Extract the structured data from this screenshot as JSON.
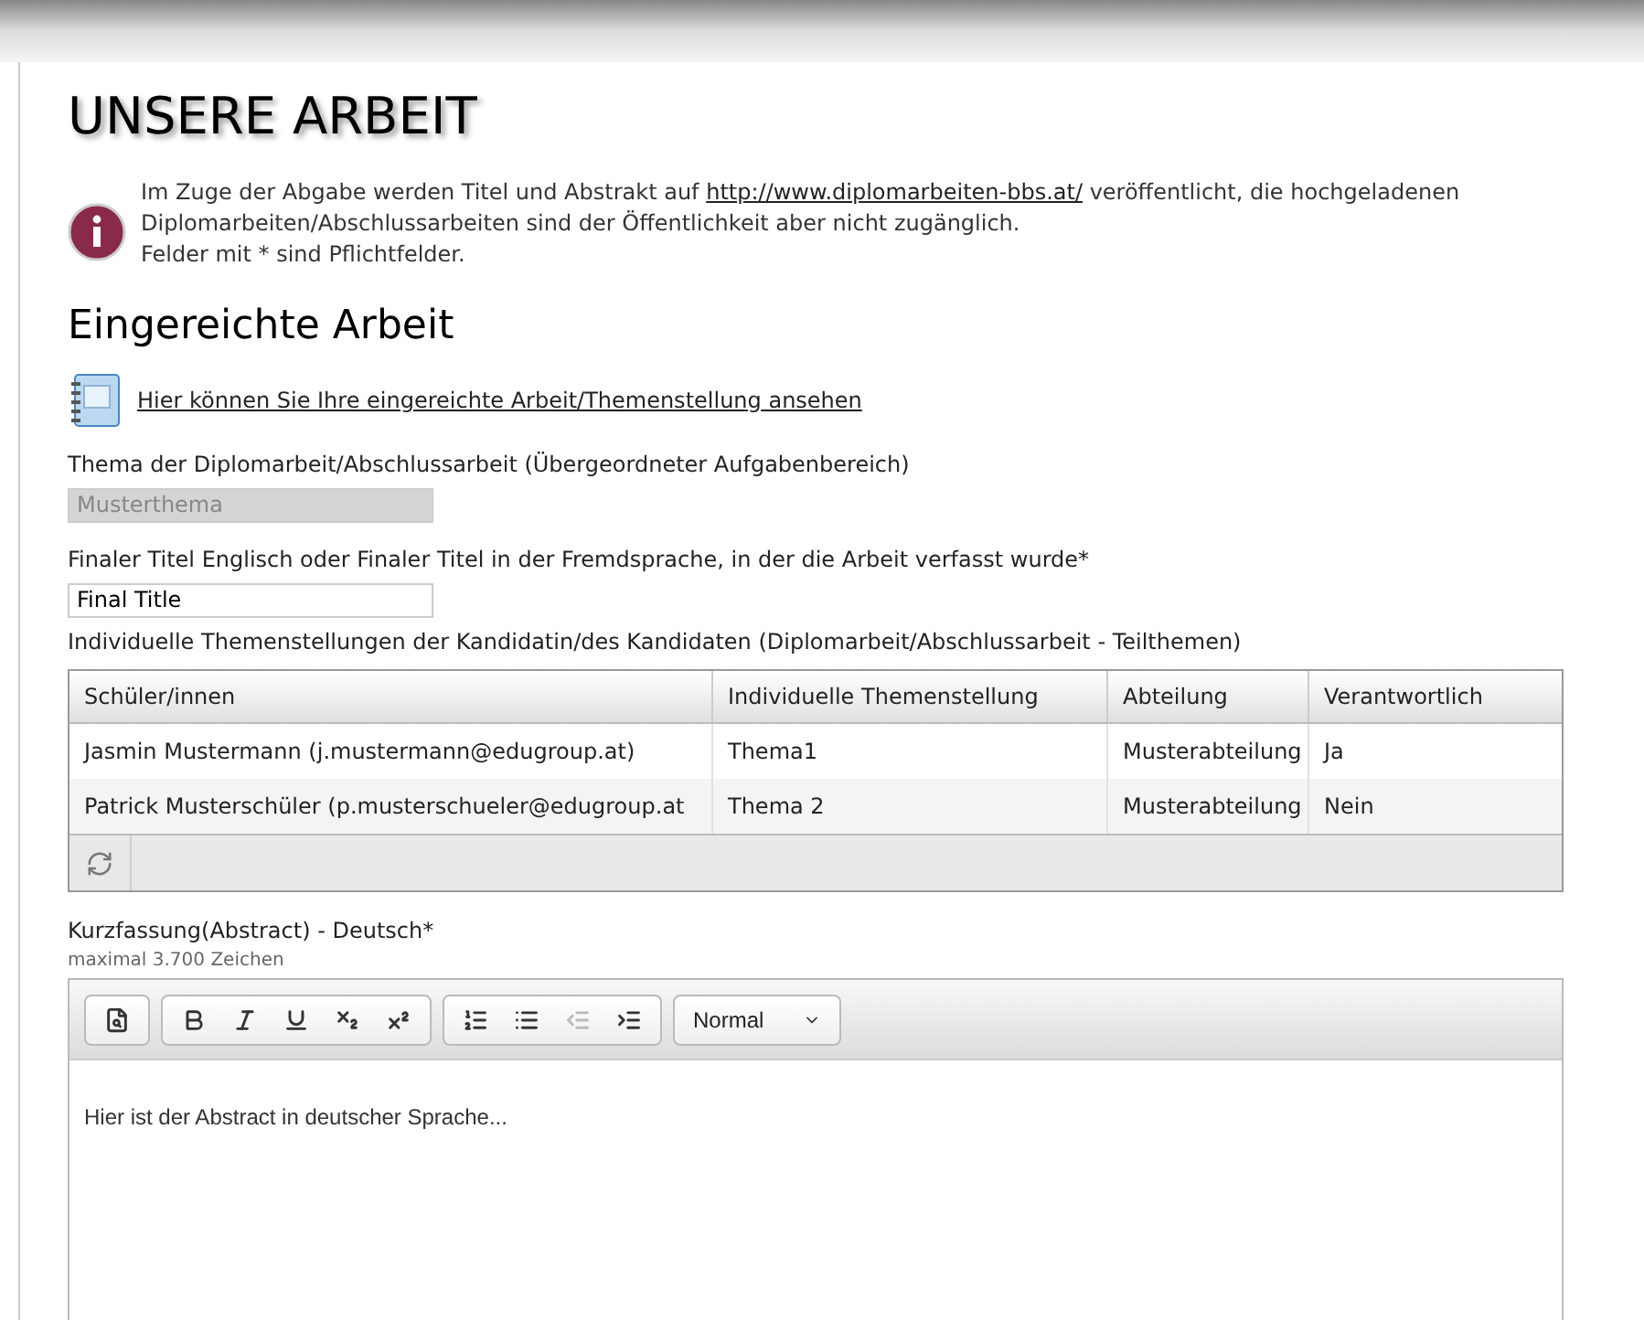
{
  "page_title": "UNSERE ARBEIT",
  "notice": {
    "text_before": "Im Zuge der Abgabe werden Titel und Abstrakt auf ",
    "link": "http://www.diplomarbeiten-bbs.at/",
    "text_after": " veröffentlicht, die hochgeladenen Diplomarbeiten/Abschlussarbeiten sind der Öffentlichkeit aber nicht zugänglich.",
    "required_note": "Felder mit * sind Pflichtfelder."
  },
  "section_title": "Eingereichte Arbeit",
  "view_link": "Hier können Sie Ihre eingereichte Arbeit/Themenstellung ansehen",
  "fields": [
    {
      "label": "Thema der Diplomarbeit/Abschlussarbeit (Übergeordneter Aufgabenbereich)",
      "value": "Musterthema",
      "disabled": true
    },
    {
      "label": "Finaler Titel Englisch oder Finaler Titel in der Fremdsprache, in der die Arbeit verfasst wurde*",
      "value": "Final Title",
      "disabled": false
    }
  ],
  "table_label": "Individuelle Themenstellungen der Kandidatin/des Kandidaten (Diplomarbeit/Abschlussarbeit - Teilthemen)",
  "table": {
    "columns": [
      "Schüler/innen",
      "Individuelle Themenstellung",
      "Abteilung",
      "Verantwortlich"
    ],
    "rows": [
      [
        "Jasmin Mustermann (j.mustermann@edugroup.at)",
        "Thema1",
        "Musterabteilung",
        "Ja"
      ],
      [
        "Patrick Musterschüler (p.musterschueler@edugroup.at",
        "Thema 2",
        "Musterabteilung",
        "Nein"
      ]
    ]
  },
  "abstract": {
    "label": "Kurzfassung(Abstract) - Deutsch*",
    "hint": "maximal 3.700 Zeichen",
    "format": "Normal",
    "text": "Hier ist der Abstract in deutscher Sprache...",
    "toolbar": [
      [
        {
          "kind": "preview",
          "disabled": false
        }
      ],
      [
        {
          "kind": "bold",
          "disabled": false
        },
        {
          "kind": "italic",
          "disabled": false
        },
        {
          "kind": "underline",
          "disabled": false
        },
        {
          "kind": "subscript",
          "disabled": false
        },
        {
          "kind": "superscript",
          "disabled": false
        }
      ],
      [
        {
          "kind": "numbered-list",
          "disabled": false
        },
        {
          "kind": "bullet-list",
          "disabled": false
        },
        {
          "kind": "outdent",
          "disabled": true
        },
        {
          "kind": "indent",
          "disabled": false
        }
      ]
    ]
  }
}
